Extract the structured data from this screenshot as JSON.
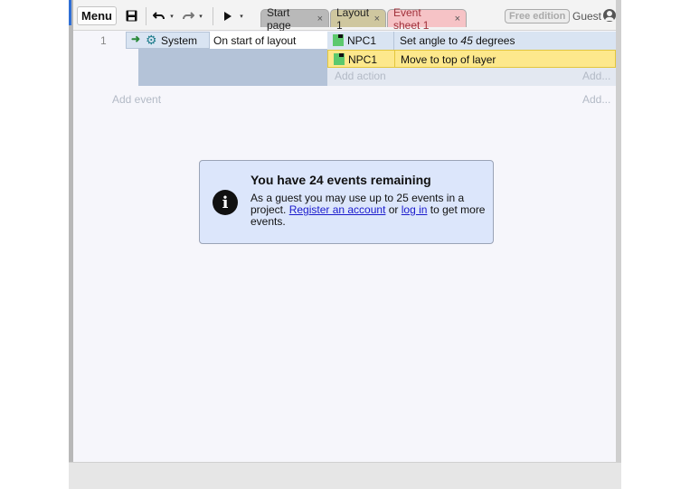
{
  "toolbar": {
    "menu_label": "Menu",
    "caret": "▾",
    "tabs": [
      {
        "label": "Start page"
      },
      {
        "label": "Layout 1"
      },
      {
        "label": "Event sheet 1"
      }
    ],
    "tab_close": "×",
    "free_edition": "Free edition",
    "guest_label": "Guest"
  },
  "event_sheet": {
    "event_number": "1",
    "condition": {
      "object": "System",
      "text": "On start of layout"
    },
    "actions": [
      {
        "object": "NPC1",
        "text_prefix": "Set angle to ",
        "text_value": "45",
        "text_suffix": " degrees"
      },
      {
        "object": "NPC1",
        "text": "Move to top of layer"
      }
    ],
    "add_action": "Add action",
    "add_action_right": "Add...",
    "add_event": "Add event",
    "add_event_right": "Add..."
  },
  "notice": {
    "title": "You have 24 events remaining",
    "body_prefix": "As a guest you may use up to 25 events in a project. ",
    "register_link": "Register an account",
    "middle": " or ",
    "login_link": "log in",
    "suffix": " to get more events."
  },
  "colors": {
    "accent_blue": "#2f6fd6",
    "selected_action": "#fde88c",
    "notice_bg": "#dce6fb",
    "npc_green": "#5cc96d"
  },
  "icons": [
    "save-icon",
    "undo-icon",
    "redo-icon",
    "play-icon",
    "gear-icon",
    "green-arrow-icon",
    "info-icon",
    "user-icon"
  ]
}
